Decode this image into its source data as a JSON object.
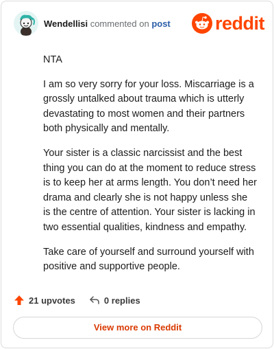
{
  "header": {
    "username": "Wendellisi",
    "verb": "commented on",
    "target_link": "post",
    "logo_text": "reddit",
    "brand_color": "#ff4500"
  },
  "comment": {
    "paragraphs": [
      "NTA",
      "I am so very sorry for your loss. Miscarriage is a grossly untalked about trauma which is utterly devastating to most women and their partners both physically and mentally.",
      "Your sister is a classic narcissist and the best thing you can do at the moment to reduce stress is to keep her at arms length. You don’t need her drama and clearly she is not happy unless she is the centre of attention. Your sister is lacking in two essential qualities, kindness and empathy.",
      "Take care of yourself and surround yourself with positive and supportive people."
    ]
  },
  "actions": {
    "upvotes_label": "21 upvotes",
    "replies_label": "0 replies",
    "upvote_icon": "arrow-up-icon",
    "reply_icon": "reply-arrow-icon"
  },
  "footer": {
    "view_more_label": "View more on Reddit"
  }
}
